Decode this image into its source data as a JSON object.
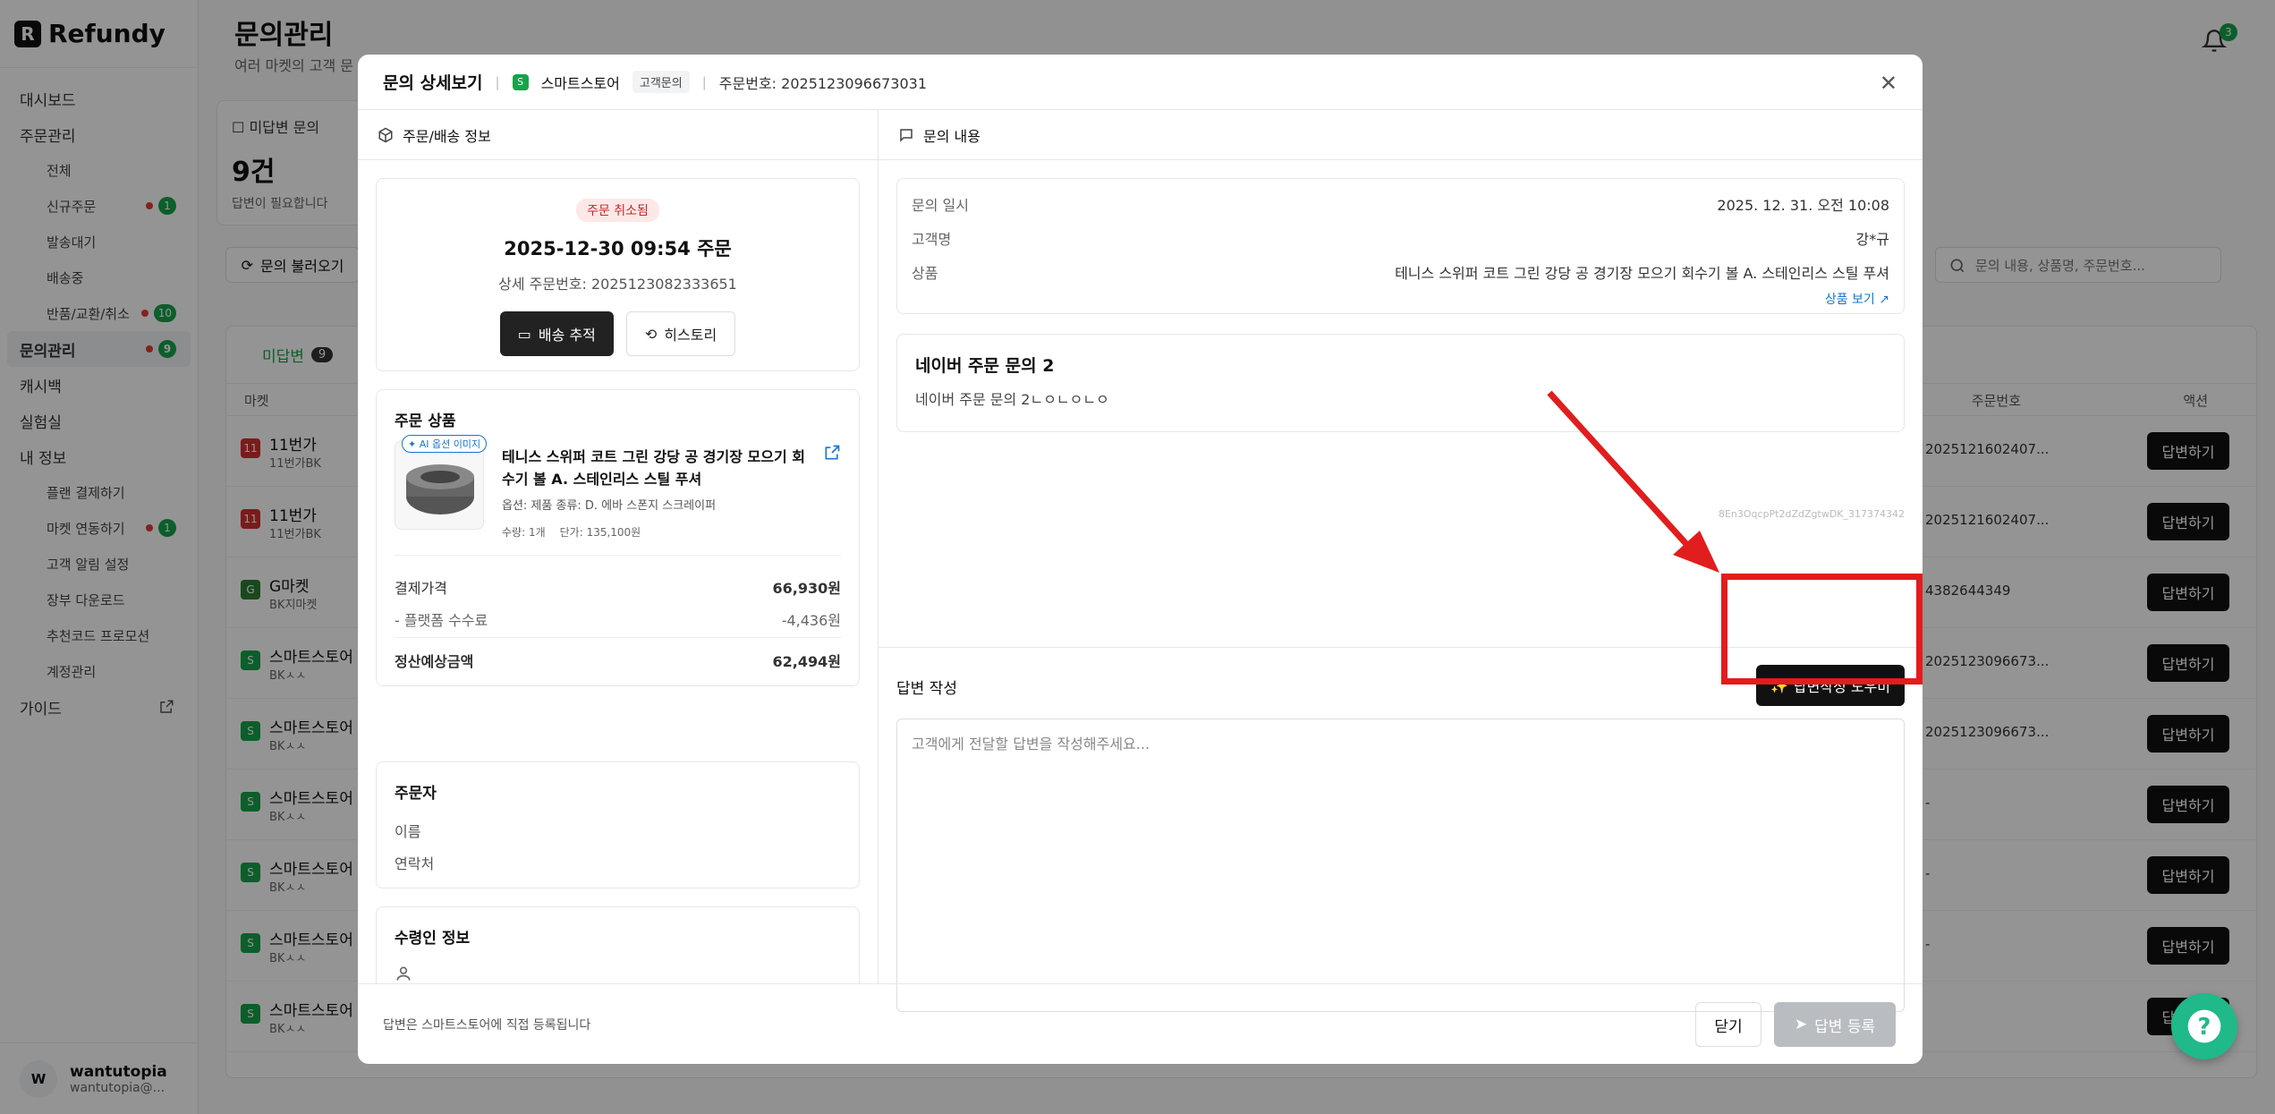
{
  "app": {
    "name": "Refundy"
  },
  "sidebar": {
    "items": [
      {
        "label": "대시보드"
      },
      {
        "label": "주문관리"
      },
      {
        "label": "전체"
      },
      {
        "label": "신규주문",
        "count": "1"
      },
      {
        "label": "발송대기"
      },
      {
        "label": "배송중"
      },
      {
        "label": "반품/교환/취소",
        "count": "10"
      },
      {
        "label": "문의관리",
        "count": "9"
      },
      {
        "label": "캐시백"
      },
      {
        "label": "실험실"
      },
      {
        "label": "내 정보"
      },
      {
        "label": "플랜 결제하기"
      },
      {
        "label": "마켓 연동하기",
        "count": "1"
      },
      {
        "label": "고객 알림 설정"
      },
      {
        "label": "장부 다운로드"
      },
      {
        "label": "추천코드 프로모션"
      },
      {
        "label": "계정관리"
      },
      {
        "label": "가이드"
      }
    ],
    "profile": {
      "initial": "W",
      "name": "wantutopia",
      "email": "wantutopia@..."
    }
  },
  "main": {
    "title": "문의관리",
    "subtitle": "여러 마켓의 고객 문",
    "notifications": "3",
    "stat": {
      "label": "미답변 문의",
      "value": "9건",
      "note": "답변이 필요합니다"
    },
    "reload_label": "문의 불러오기",
    "search_placeholder": "문의 내용, 상품명, 주문번호...",
    "tab": {
      "label": "미답변",
      "count": "9"
    },
    "headers": {
      "market": "마켓",
      "order_no": "주문번호",
      "action": "액션"
    },
    "rows": [
      {
        "market": "11번가",
        "sub": "11번가BK",
        "order_no": "2025121602407...",
        "action": "답변하기"
      },
      {
        "market": "11번가",
        "sub": "11번가BK",
        "order_no": "2025121602407...",
        "action": "답변하기"
      },
      {
        "market": "G마켓",
        "sub": "BK지마켓",
        "order_no": "4382644349",
        "action": "답변하기"
      },
      {
        "market": "스마트스토어",
        "sub": "BKㅅㅅ",
        "order_no": "2025123096673...",
        "action": "답변하기"
      },
      {
        "market": "스마트스토어",
        "sub": "BKㅅㅅ",
        "order_no": "2025123096673...",
        "action": "답변하기"
      },
      {
        "market": "스마트스토어",
        "sub": "BKㅅㅅ",
        "order_no": "-",
        "action": "답변하기"
      },
      {
        "market": "스마트스토어",
        "sub": "BKㅅㅅ",
        "order_no": "-",
        "action": "답변하기"
      },
      {
        "market": "스마트스토어",
        "sub": "BKㅅㅅ",
        "order_no": "-",
        "action": "답변하기"
      },
      {
        "market": "스마트스토어",
        "sub": "BKㅅㅅ",
        "order_no": "",
        "action": "답변하기"
      }
    ]
  },
  "modal": {
    "title": "문의 상세보기",
    "store": "스마트스토어",
    "type_tag": "고객문의",
    "order_no": "주문번호: 2025123096673031",
    "left": {
      "section_title": "주문/배송 정보",
      "status_tag": "주문 취소됨",
      "order_date": "2025-12-30 09:54 주문",
      "detail_no": "상세 주문번호: 2025123082333651",
      "track_label": "배송 추적",
      "history_label": "히스토리",
      "product_title": "주문 상품",
      "ai_tag": "AI 옵션 이미지",
      "product_name": "테니스 스위퍼 코트 그린 강당 공 경기장 모으기 회수기 볼 A. 스테인리스 스틸 푸셔",
      "option": "옵션: 제품 종류: D. 에바 스폰지 스크레이퍼",
      "qty": "수량: 1개",
      "unit_price": "단가: 135,100원",
      "pay_label": "결제가격",
      "pay_value": "66,930원",
      "fee_label": "- 플랫폼 수수료",
      "fee_value": "-4,436원",
      "settle_label": "정산예상금액",
      "settle_value": "62,494원",
      "orderer_title": "주문자",
      "name_label": "이름",
      "contact_label": "연락처",
      "receiver_title": "수령인 정보"
    },
    "right": {
      "section_title": "문의 내용",
      "date_label": "문의 일시",
      "date_value": "2025. 12. 31. 오전 10:08",
      "customer_label": "고객명",
      "customer_value": "강*규",
      "product_label": "상품",
      "product_value": "테니스 스위퍼 코트 그린 강당 공 경기장 모으기 회수기 볼 A. 스테인리스 스틸 푸셔",
      "product_link": "상품 보기",
      "inquiry_title": "네이버 주문 문의 2",
      "inquiry_body": "네이버 주문 문의 2ㄴㅇㄴㅇㄴㅇ",
      "inquiry_id": "8En3OqcpPt2dZdZgtwDK_317374342",
      "reply_label": "답변 작성",
      "helper_label": "답변작성 도우미",
      "reply_placeholder": "고객에게 전달할 답변을 작성해주세요..."
    },
    "footer": {
      "note": "답변은 스마트스토어에 직접 등록됩니다",
      "close_label": "닫기",
      "submit_label": "답변 등록"
    }
  },
  "colors": {
    "brand": "#16a34a",
    "accent_red": "#e11d1d",
    "dark": "#111111"
  }
}
